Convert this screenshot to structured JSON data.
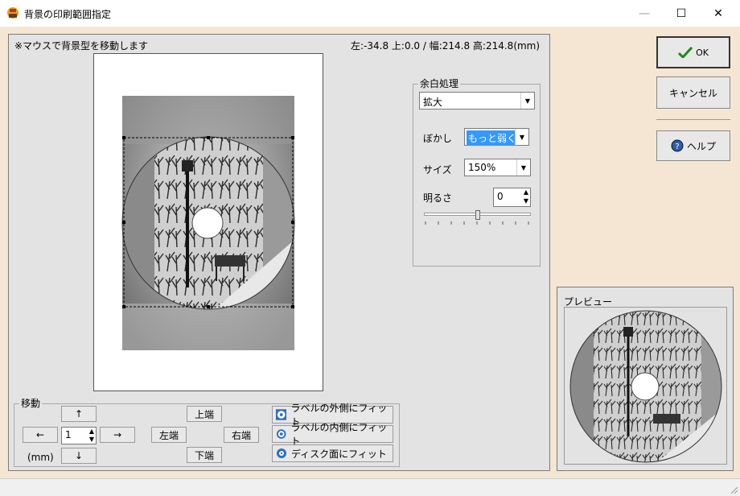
{
  "window": {
    "title": "背景の印刷範囲指定",
    "minimize": "—",
    "maximize": "☐",
    "close": "✕"
  },
  "main": {
    "hint": "※マウスで背景型を移動します",
    "coords": "左:-34.8 上:0.0 / 幅:214.8 高:214.8(mm)"
  },
  "margin_group": {
    "title": "余白処理",
    "mode_value": "拡大",
    "blur_label": "ぼかし",
    "blur_value": "もっと弱く",
    "size_label": "サイズ",
    "size_value": "150%",
    "brightness_label": "明るさ",
    "brightness_value": "0",
    "brightness_level": 0.5
  },
  "move_group": {
    "title": "移動",
    "up": "↑",
    "down": "↓",
    "left": "←",
    "right": "→",
    "step_value": "1",
    "unit": "(mm)",
    "top_edge": "上端",
    "left_edge": "左端",
    "right_edge": "右端",
    "bottom_edge": "下端"
  },
  "fit_buttons": {
    "outer": "ラベルの外側にフィット",
    "inner": "ラベルの内側にフィット",
    "disc": "ディスク面にフィット"
  },
  "right_panel": {
    "ok": "OK",
    "cancel": "キャンセル",
    "help": "ヘルプ",
    "preview_title": "プレビュー"
  },
  "colors": {
    "ok_check": "#1a8a1a",
    "selection": "#3399ff",
    "help_icon": "#2a5db0",
    "fit_icon": "#2a6fc0"
  }
}
